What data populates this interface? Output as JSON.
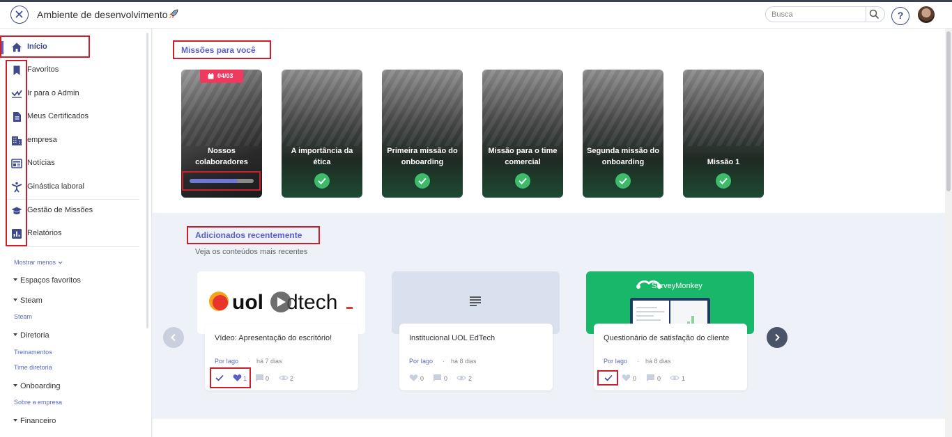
{
  "header": {
    "app_title": "Ambiente de desenvolvimento",
    "search_placeholder": "Busca",
    "help_label": "?"
  },
  "sidebar": {
    "items": [
      {
        "label": "Início",
        "icon": "home-icon",
        "active": true
      },
      {
        "label": "Favoritos",
        "icon": "bookmark-icon"
      },
      {
        "label": "Ir para o Admin",
        "icon": "admin-icon"
      },
      {
        "label": "Meus Certificados",
        "icon": "document-icon"
      },
      {
        "label": "empresa",
        "icon": "building-icon"
      },
      {
        "label": "Notícias",
        "icon": "news-icon"
      },
      {
        "label": "Ginástica laboral",
        "icon": "gym-icon"
      },
      {
        "label": "Gestão de Missões",
        "icon": "graduation-cap-icon"
      },
      {
        "label": "Relatórios",
        "icon": "bar-chart-icon"
      }
    ],
    "show_less": "Mostrar menos",
    "groups": [
      {
        "title": "Espaços favoritos",
        "items": []
      },
      {
        "title": "Steam",
        "items": [
          "Steam"
        ]
      },
      {
        "title": "Diretoria",
        "items": [
          "Treinamentos",
          "Time diretoria"
        ]
      },
      {
        "title": "Onboarding",
        "items": [
          "Sobre a empresa"
        ]
      },
      {
        "title": "Financeiro",
        "items": []
      }
    ]
  },
  "missions": {
    "title": "Missões para você",
    "cards": [
      {
        "title": "Nossos colaboradores",
        "badge": "04/03",
        "progress": 0.75,
        "done": false
      },
      {
        "title": "A importância da ética",
        "done": true
      },
      {
        "title": "Primeira missão do onboarding",
        "done": true
      },
      {
        "title": "Missão para o time comercial",
        "done": true
      },
      {
        "title": "Segunda missão do onboarding",
        "done": true
      },
      {
        "title": "Missão 1",
        "done": true
      }
    ]
  },
  "recent": {
    "title": "Adicionados recentemente",
    "subtitle": "Veja os conteúdos mais recentes",
    "cards": [
      {
        "title": "Vídeo: Apresentação do escritório!",
        "author": "Por Iago",
        "separator": "·",
        "ago": "há 7 dias",
        "likes": "1",
        "comments": "0",
        "views": "2",
        "completed": true,
        "liked": true,
        "thumb_logo": "uol edtech"
      },
      {
        "title": "Institucional UOL EdTech",
        "author": "Por Iago",
        "separator": "·",
        "ago": "há 8 dias",
        "likes": "0",
        "comments": "0",
        "views": "2",
        "completed": false,
        "liked": false
      },
      {
        "title": "Questionário de satisfação do cliente",
        "author": "Por Iago",
        "separator": "·",
        "ago": "há 8 dias",
        "likes": "0",
        "comments": "0",
        "views": "1",
        "completed": true,
        "liked": false,
        "thumb_logo": "SurveyMonkey"
      }
    ]
  },
  "colors": {
    "accent": "#5b5fc7",
    "sidebar_icon": "#3f4a8c",
    "success": "#3dbb6a",
    "badge": "#f0395f",
    "surveymonkey": "#19b76a",
    "annotation_red": "#cc1f2b"
  }
}
